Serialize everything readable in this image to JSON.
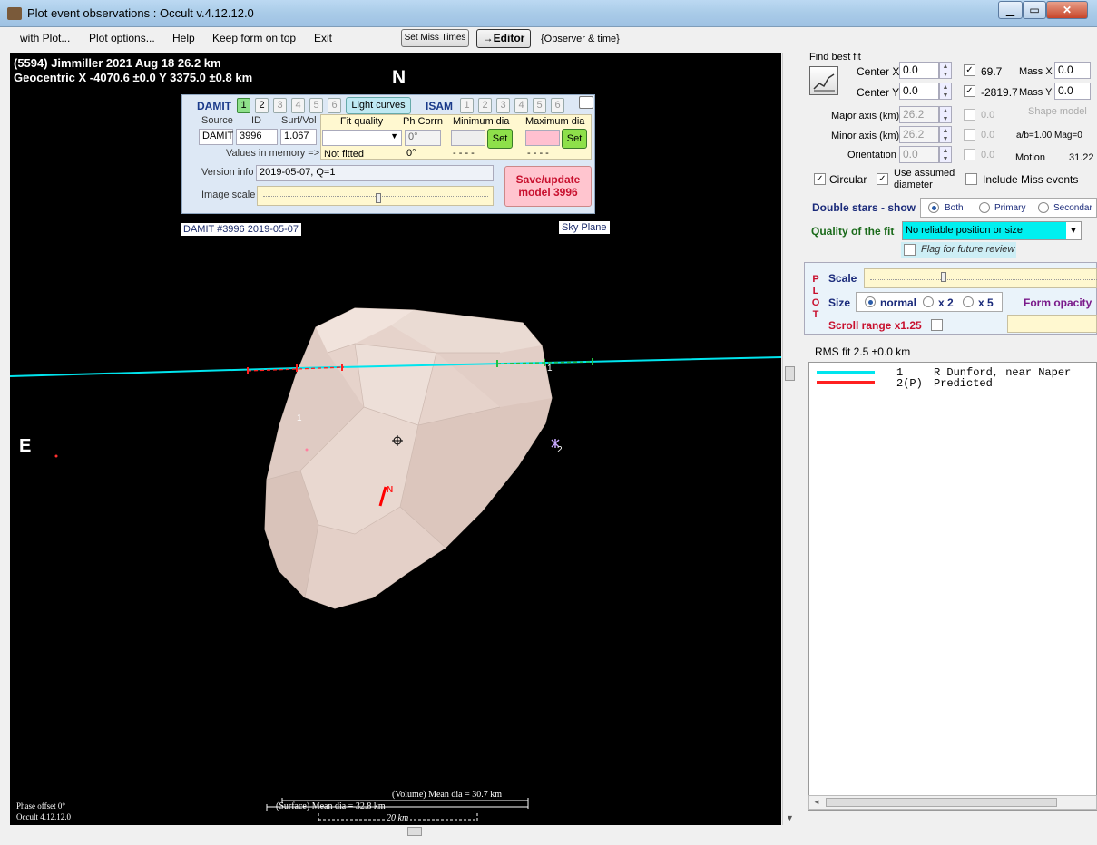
{
  "window": {
    "title": "Plot event observations : Occult v.4.12.12.0",
    "controls": {
      "minimize": "▁",
      "maximize": "▭",
      "close": "✕"
    }
  },
  "menu": {
    "items": [
      "with Plot...",
      "Plot options...",
      "Help",
      "Keep form on top",
      "Exit"
    ],
    "set_miss_times": "Set Miss Times",
    "editor": "→Editor",
    "observer_time": "{Observer & time}"
  },
  "plot": {
    "header_line1": "(5594) Jimmiller  2021 Aug 18   26.2 km",
    "header_line2": "Geocentric  X  -4070.6 ±0.0  Y 3375.0 ±0.8 km",
    "north": "N",
    "east": "E",
    "model_label": "DAMIT #3996 2019-05-07",
    "sky_plane": "Sky Plane",
    "chord_label_1a": "1",
    "chord_label_1b": "1",
    "chord_label_2": "2",
    "pole_label": "N",
    "phase_offset": "Phase offset 0°",
    "version": "Occult 4.12.12.0",
    "volume_dia": "(Volume) Mean dia = 30.7 km",
    "surface_dia": "(Surface) Mean dia = 32.8 km",
    "scale_20km": "20 km",
    "colors": {
      "chord_observed": "#00e5ee",
      "chord_predicted": "#ff2020",
      "shape": "#e6d3cb"
    }
  },
  "damit": {
    "title": "DAMIT",
    "model_buttons": [
      "1",
      "2",
      "3",
      "4",
      "5",
      "6"
    ],
    "light_curves": "Light curves",
    "isam": "ISAM",
    "isam_buttons": [
      "1",
      "2",
      "3",
      "4",
      "5",
      "6"
    ],
    "source_label": "Source",
    "id_label": "ID",
    "surfvol_label": "Surf/Vol",
    "source": "DAMIT",
    "id": "3996",
    "surfvol": "1.067",
    "values_in_memory": "Values in memory =>",
    "fit_quality": "Fit quality",
    "ph_corrn": "Ph Corrn",
    "min_dia": "Minimum dia",
    "max_dia": "Maximum dia",
    "ph_corrn_value": "0°",
    "set": "Set",
    "not_fitted": "Not fitted",
    "ph_mem": "0°",
    "min_mem": "- - - -",
    "max_mem": "- - - -",
    "version_info_label": "Version info",
    "version_info": "2019-05-07, Q=1",
    "image_scale_label": "Image scale",
    "save_update_1": "Save/update",
    "save_update_2": "model 3996"
  },
  "fit": {
    "find_best_fit": "Find best fit",
    "center_x_label": "Center X",
    "center_x": "0.0",
    "center_y_label": "Center Y",
    "center_y": "0.0",
    "x_val": "69.7",
    "y_val": "-2819.7",
    "mass_x_label": "Mass X",
    "mass_x": "0.0",
    "mass_y_label": "Mass Y",
    "mass_y": "0.0",
    "major_axis_label": "Major axis (km)",
    "major_axis": "26.2",
    "minor_axis_label": "Minor axis (km)",
    "minor_axis": "26.2",
    "orientation_label": "Orientation",
    "orientation": "0.0",
    "major_chk_val": "0.0",
    "minor_chk_val": "0.0",
    "orient_chk_val": "0.0",
    "shape_model": "Shape model",
    "ab_mag": "a/b=1.00  Mag=0",
    "motion_label": "Motion",
    "motion": "31.22",
    "circular": "Circular",
    "use_assumed_1": "Use assumed",
    "use_assumed_2": "diameter",
    "include_miss": "Include Miss events",
    "double_stars": "Double stars - show",
    "both": "Both",
    "primary": "Primary",
    "secondary": "Secondar",
    "quality_label": "Quality of the fit",
    "quality_value": "No reliable position or size",
    "flag_review": "Flag for future review"
  },
  "plotpanel": {
    "plot_letters": [
      "P",
      "L",
      "O",
      "T"
    ],
    "scale": "Scale",
    "size": "Size",
    "normal": "normal",
    "x2": "x 2",
    "x5": "x 5",
    "form_opacity": "Form opacity",
    "scroll_range": "Scroll range x1.25"
  },
  "results": {
    "rms_fit": "RMS fit 2.5 ±0.0 km",
    "legend": [
      {
        "num": "1",
        "text": "R Dunford, near Naper",
        "color": "#00e5ee"
      },
      {
        "num": "2(P)",
        "text": "Predicted",
        "color": "#ff2020"
      }
    ]
  }
}
